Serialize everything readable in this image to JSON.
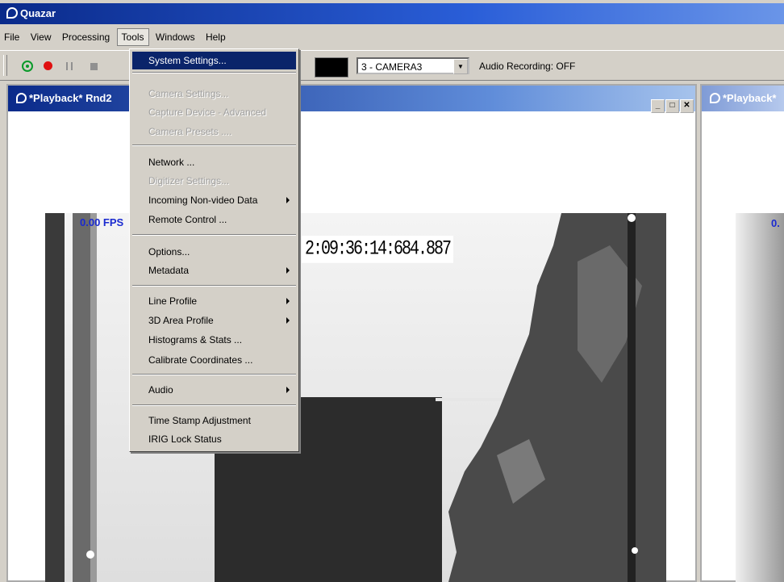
{
  "app": {
    "title": "Quazar"
  },
  "menubar": [
    "File",
    "View",
    "Processing",
    "Tools",
    "Windows",
    "Help"
  ],
  "toolbar": {
    "camera_select": "3 - CAMERA3",
    "audio_status": "Audio Recording: OFF"
  },
  "windows": [
    {
      "title": "*Playback* Rnd2",
      "fps": "0.00 FPS",
      "timestamp": "2:09:36:14:684.887"
    },
    {
      "title": "*Playback*",
      "fps": "0."
    }
  ],
  "tools_menu": {
    "items": [
      {
        "label": "System Settings...",
        "state": "selected"
      },
      {
        "label": "Camera Settings...",
        "state": "disabled"
      },
      {
        "label": "Capture Device - Advanced",
        "state": "disabled"
      },
      {
        "label": "Camera Presets ....",
        "state": "disabled"
      },
      {
        "label": "Network ...",
        "state": "enabled"
      },
      {
        "label": "Digitizer Settings...",
        "state": "disabled"
      },
      {
        "label": "Incoming Non-video Data",
        "state": "enabled",
        "submenu": true
      },
      {
        "label": "Remote Control ...",
        "state": "enabled"
      },
      {
        "label": "Options...",
        "state": "enabled"
      },
      {
        "label": "Metadata",
        "state": "enabled",
        "submenu": true
      },
      {
        "label": "Line Profile",
        "state": "enabled",
        "submenu": true
      },
      {
        "label": "3D Area Profile",
        "state": "enabled",
        "submenu": true
      },
      {
        "label": "Histograms & Stats ...",
        "state": "enabled"
      },
      {
        "label": "Calibrate Coordinates ...",
        "state": "enabled"
      },
      {
        "label": "Audio",
        "state": "enabled",
        "submenu": true
      },
      {
        "label": "Time Stamp Adjustment",
        "state": "enabled"
      },
      {
        "label": "IRIG Lock Status",
        "state": "enabled"
      }
    ]
  }
}
